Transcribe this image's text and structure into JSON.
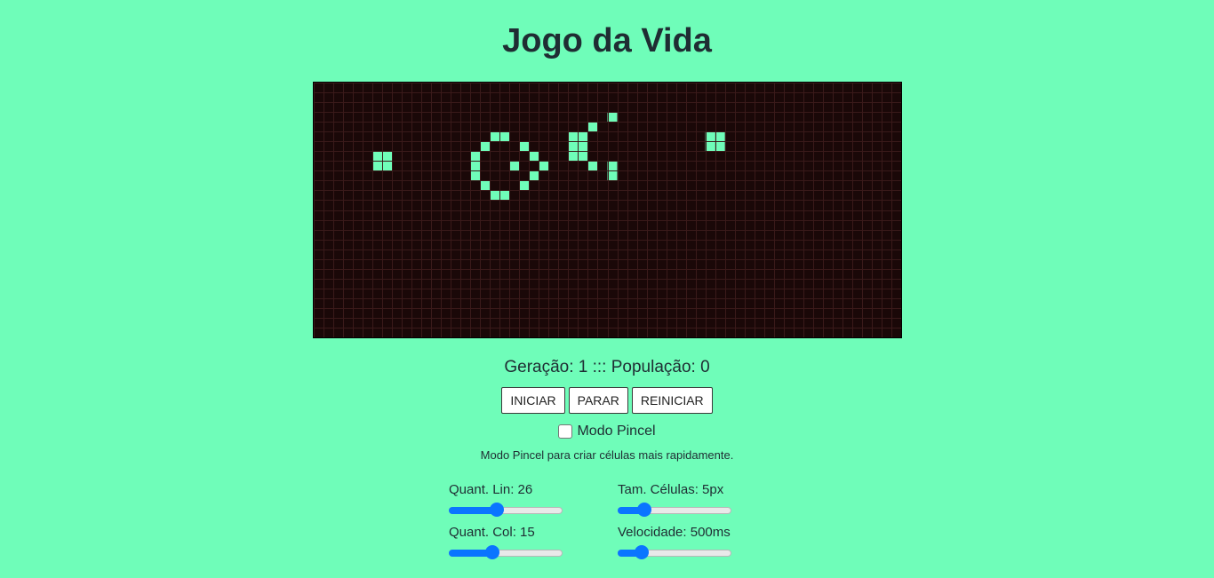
{
  "title": "Jogo da Vida",
  "board": {
    "cols": 60,
    "rows": 26,
    "cell_color": "#6ffdb9",
    "grid_line_color": "#3a1a1a",
    "background_color": "#1a0808",
    "live_cells": [
      [
        6,
        7
      ],
      [
        7,
        7
      ],
      [
        6,
        8
      ],
      [
        7,
        8
      ],
      [
        18,
        5
      ],
      [
        19,
        5
      ],
      [
        17,
        6
      ],
      [
        21,
        6
      ],
      [
        16,
        7
      ],
      [
        22,
        7
      ],
      [
        16,
        8
      ],
      [
        20,
        8
      ],
      [
        23,
        8
      ],
      [
        16,
        9
      ],
      [
        22,
        9
      ],
      [
        17,
        10
      ],
      [
        21,
        10
      ],
      [
        18,
        11
      ],
      [
        19,
        11
      ],
      [
        30,
        3
      ],
      [
        28,
        4
      ],
      [
        26,
        5
      ],
      [
        27,
        5
      ],
      [
        26,
        6
      ],
      [
        27,
        6
      ],
      [
        26,
        7
      ],
      [
        27,
        7
      ],
      [
        28,
        8
      ],
      [
        30,
        8
      ],
      [
        30,
        9
      ],
      [
        40,
        5
      ],
      [
        41,
        5
      ],
      [
        40,
        6
      ],
      [
        41,
        6
      ]
    ]
  },
  "stats": {
    "text": "Geração: 1 ::: População: 0"
  },
  "buttons": {
    "start": "INICIAR",
    "stop": "PARAR",
    "reset": "REINICIAR"
  },
  "brush": {
    "label": "Modo Pincel",
    "checked": false,
    "hint": "Modo Pincel para criar células mais rapidamente."
  },
  "controls": {
    "rows": {
      "label": "Quant. Lin: 26",
      "fraction": 0.42
    },
    "cols": {
      "label": "Quant. Col: 15",
      "fraction": 0.37
    },
    "cell_size": {
      "label": "Tam. Células: 5px",
      "fraction": 0.2
    },
    "speed": {
      "label": "Velocidade: 500ms",
      "fraction": 0.17
    }
  },
  "colors": {
    "background": "#6ffdb9",
    "accent": "#0a75ff"
  }
}
